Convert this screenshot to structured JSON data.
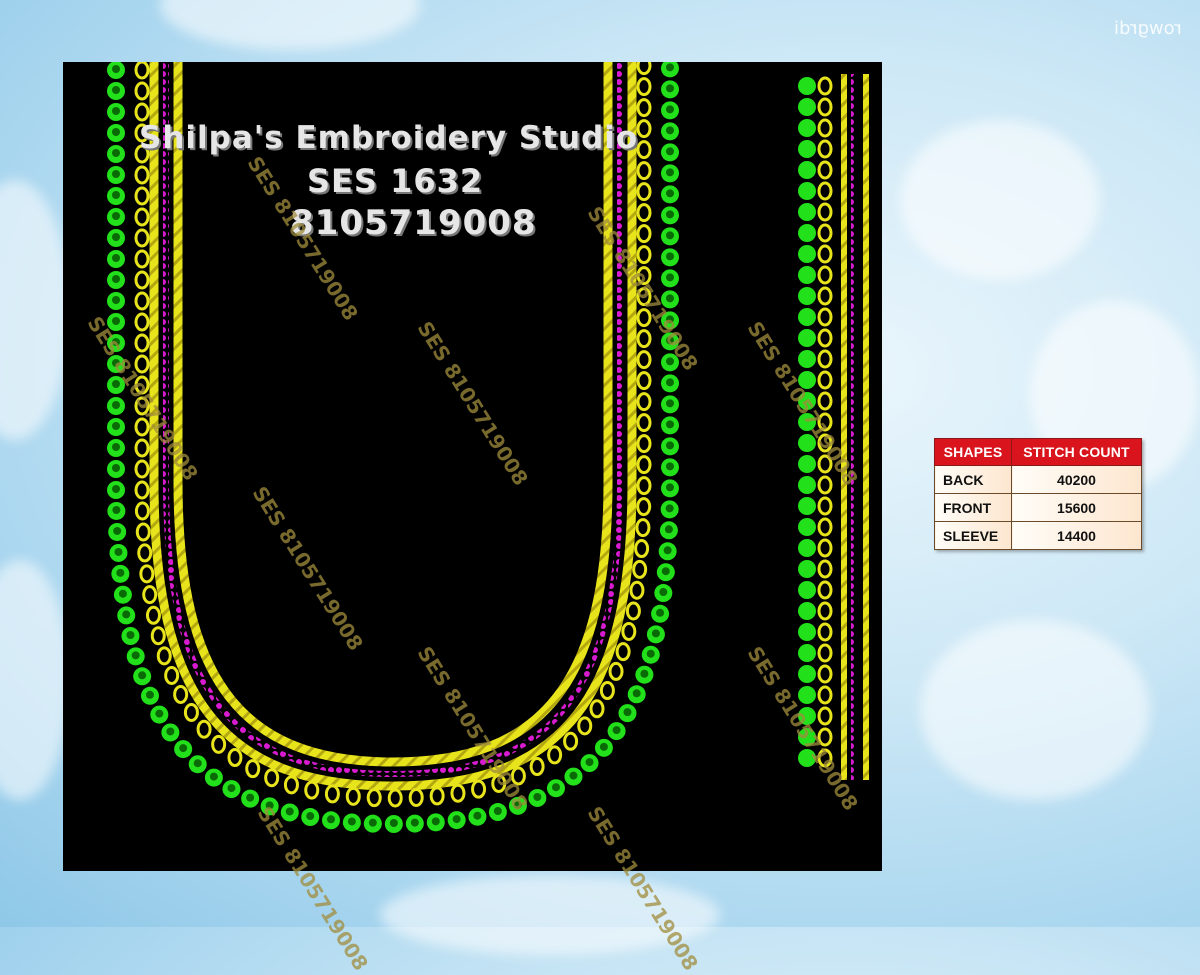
{
  "signature": "rowgrdi",
  "design": {
    "studio_name": "Shilpa's Embroidery Studio",
    "design_code": "SES 1632",
    "phone": "8105719008"
  },
  "watermark_text": "SES 8105719008",
  "colors": {
    "background_fabric": "#000000",
    "leaf_green": "#22e01a",
    "gold_yellow": "#e8e41c",
    "magenta": "#d81bd0",
    "table_header": "#d9141c"
  },
  "stitch_table": {
    "headers": [
      "SHAPES",
      "STITCH COUNT"
    ],
    "rows": [
      {
        "shape": "BACK",
        "count": "40200"
      },
      {
        "shape": "FRONT",
        "count": "15600"
      },
      {
        "shape": "SLEEVE",
        "count": "14400"
      }
    ]
  }
}
